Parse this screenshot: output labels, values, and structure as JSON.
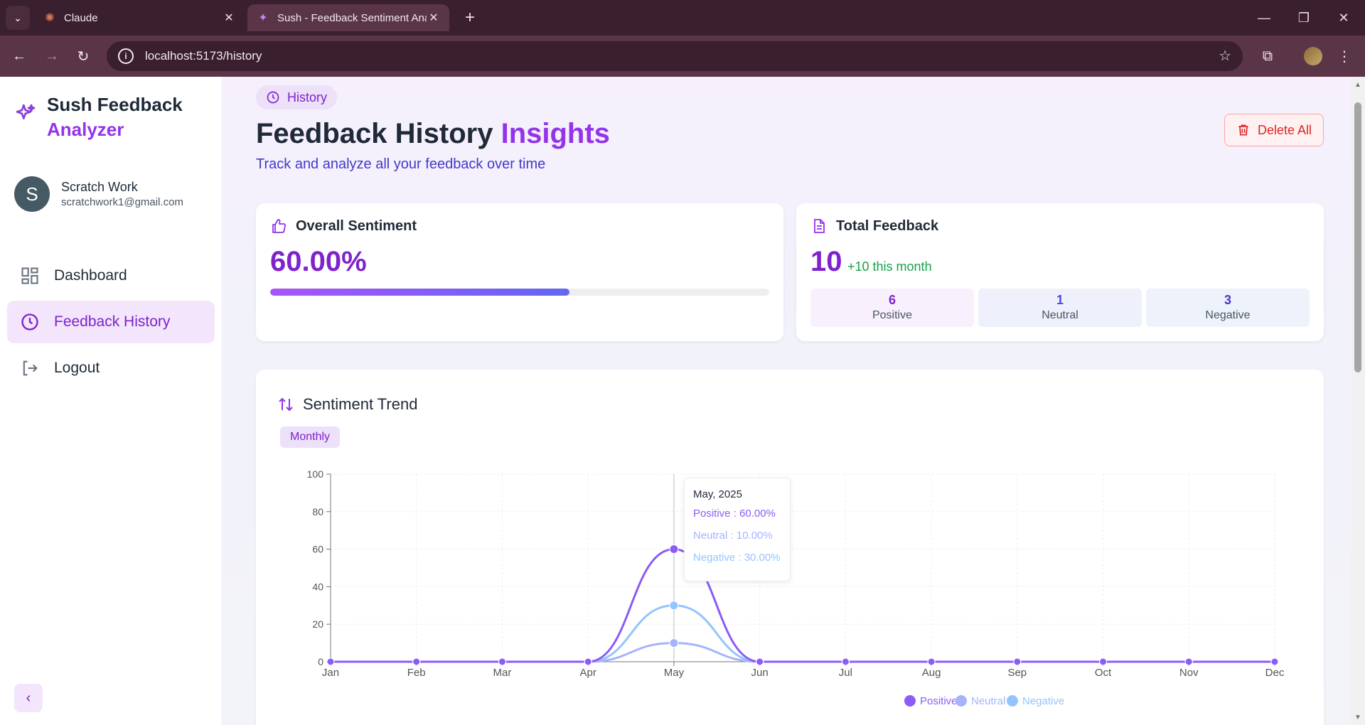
{
  "browser": {
    "tabs": [
      {
        "title": "Claude"
      },
      {
        "title": "Sush - Feedback Sentiment Ana"
      }
    ],
    "url": "localhost:5173/history"
  },
  "sidebar": {
    "brand_line1": "Sush Feedback",
    "brand_line2": "Analyzer",
    "user": {
      "initial": "S",
      "name": "Scratch Work",
      "email": "scratchwork1@gmail.com"
    },
    "items": [
      {
        "label": "Dashboard",
        "icon": "grid-icon"
      },
      {
        "label": "Feedback History",
        "icon": "clock-icon",
        "active": true
      },
      {
        "label": "Logout",
        "icon": "logout-icon"
      }
    ]
  },
  "header": {
    "pill": "History",
    "title_main": "Feedback History ",
    "title_highlight": "Insights",
    "subtitle": "Track and analyze all your feedback over time",
    "delete_label": "Delete All"
  },
  "overall": {
    "title": "Overall Sentiment",
    "value_text": "60.00%",
    "value": 0.6
  },
  "total": {
    "title": "Total Feedback",
    "count": "10",
    "delta": "+10 this month",
    "stats": [
      {
        "value": "6",
        "label": "Positive"
      },
      {
        "value": "1",
        "label": "Neutral"
      },
      {
        "value": "3",
        "label": "Negative"
      }
    ]
  },
  "trend": {
    "title": "Sentiment Trend",
    "period": "Monthly",
    "tooltip": {
      "title": "May, 2025",
      "rows": [
        "Positive : 60.00%",
        "Neutral : 10.00%",
        "Negative : 30.00%"
      ]
    }
  },
  "colors": {
    "positive": "#8b5cf6",
    "neutral": "#a5b4fc",
    "negative": "#93c5fd",
    "accent": "#9333ea"
  },
  "chart_data": {
    "type": "line",
    "categories": [
      "Jan",
      "Feb",
      "Mar",
      "Apr",
      "May",
      "Jun",
      "Jul",
      "Aug",
      "Sep",
      "Oct",
      "Nov",
      "Dec"
    ],
    "series": [
      {
        "name": "Positive",
        "values": [
          0,
          0,
          0,
          0,
          60,
          0,
          0,
          0,
          0,
          0,
          0,
          0
        ]
      },
      {
        "name": "Neutral",
        "values": [
          0,
          0,
          0,
          0,
          10,
          0,
          0,
          0,
          0,
          0,
          0,
          0
        ]
      },
      {
        "name": "Negative",
        "values": [
          0,
          0,
          0,
          0,
          30,
          0,
          0,
          0,
          0,
          0,
          0,
          0
        ]
      }
    ],
    "ylim": [
      0,
      100
    ],
    "yticks": [
      0,
      20,
      40,
      60,
      80,
      100
    ],
    "legend": "bottom",
    "grid": true
  }
}
